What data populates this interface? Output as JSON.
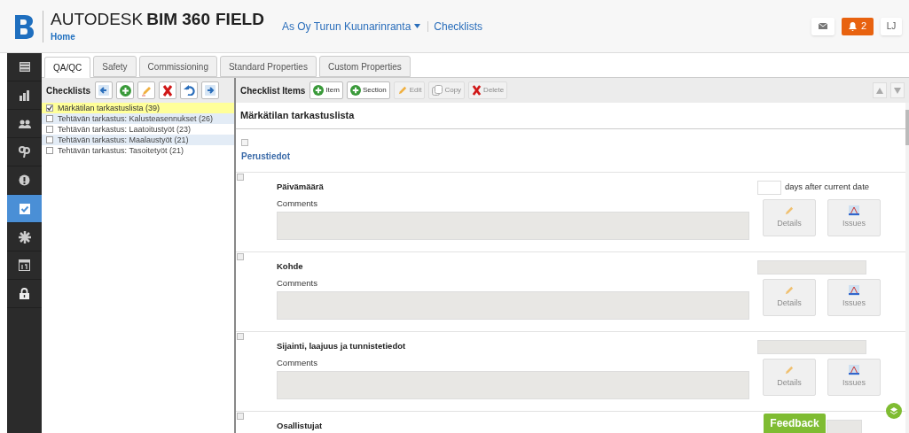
{
  "header": {
    "brand_prefix": "AUTODESK",
    "brand_suffix": "BIM 360",
    "brand_product": "FIELD",
    "home": "Home",
    "project": "As Oy Turun Kuunarinranta",
    "breadcrumb": "Checklists",
    "notifications": "2",
    "user": "LJ"
  },
  "sidebar": {
    "items": [
      {
        "selected": false
      },
      {
        "selected": false
      },
      {
        "selected": false
      },
      {
        "selected": false
      },
      {
        "selected": false
      },
      {
        "selected": true
      },
      {
        "selected": false
      },
      {
        "selected": false
      },
      {
        "selected": false
      }
    ]
  },
  "tabs": [
    {
      "label": "QA/QC",
      "selected": true
    },
    {
      "label": "Safety",
      "selected": false
    },
    {
      "label": "Commissioning",
      "selected": false
    },
    {
      "label": "Standard Properties",
      "selected": false
    },
    {
      "label": "Custom Properties",
      "selected": false
    }
  ],
  "checklists": {
    "title": "Checklists",
    "items": [
      {
        "label": "Märkätilan tarkastuslista (39)",
        "checked": true,
        "selected": true
      },
      {
        "label": "Tehtävän tarkastus: Kalusteasennukset (26)",
        "checked": false,
        "selected": false
      },
      {
        "label": "Tehtävän tarkastus: Laatoitustyöt (23)",
        "checked": false,
        "selected": false
      },
      {
        "label": "Tehtävän tarkastus: Maalaustyöt (21)",
        "checked": false,
        "selected": false
      },
      {
        "label": "Tehtävän tarkastus: Tasoitetyöt (21)",
        "checked": false,
        "selected": false
      }
    ]
  },
  "checklist_items": {
    "title": "Checklist Items",
    "buttons": [
      {
        "label": "Item",
        "kind": "add",
        "disabled": false
      },
      {
        "label": "Section",
        "kind": "add",
        "disabled": false
      },
      {
        "label": "Edit",
        "kind": "edit",
        "disabled": true
      },
      {
        "label": "Copy",
        "kind": "copy",
        "disabled": true
      },
      {
        "label": "Delete",
        "kind": "delete",
        "disabled": true
      }
    ],
    "checklist_title": "Märkätilan tarkastuslista",
    "section": "Perustiedot",
    "section_checked": false,
    "items": [
      {
        "kind": "date",
        "title": "Päivämäärä",
        "checked": false,
        "comments_label": "Comments",
        "suffix": "days after current date",
        "details": "Details",
        "issues": "Issues"
      },
      {
        "kind": "text",
        "title": "Kohde",
        "checked": false,
        "comments_label": "Comments",
        "details": "Details",
        "issues": "Issues"
      },
      {
        "kind": "text",
        "title": "Sijainti, laajuus ja tunnistetiedot",
        "checked": false,
        "comments_label": "Comments",
        "details": "Details",
        "issues": "Issues"
      },
      {
        "kind": "text",
        "title": "Osallistujat",
        "checked": false
      }
    ]
  },
  "feedback": "Feedback"
}
